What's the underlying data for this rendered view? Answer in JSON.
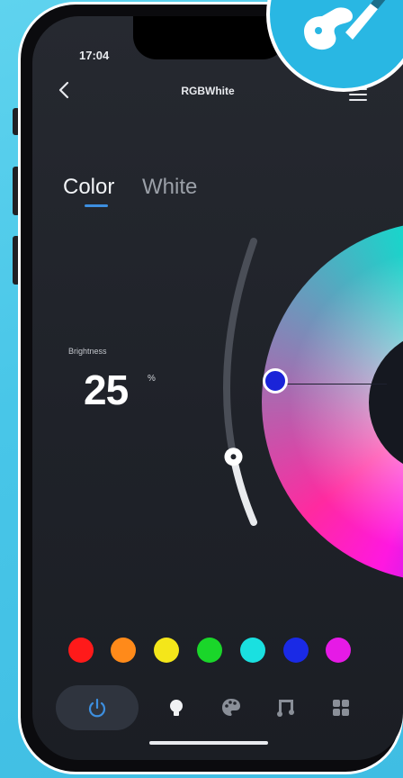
{
  "status_bar": {
    "time": "17:04"
  },
  "header": {
    "title": "RGBWhite"
  },
  "mode_tabs": [
    {
      "label": "Color",
      "active": true
    },
    {
      "label": "White",
      "active": false
    }
  ],
  "brightness": {
    "label": "Brightness",
    "value": "25",
    "unit": "%",
    "level": 0.25
  },
  "color_picker": {
    "selected_color": "#1a24d8"
  },
  "swatches": [
    {
      "name": "red",
      "color": "#ff1a1a"
    },
    {
      "name": "orange",
      "color": "#ff8a1a"
    },
    {
      "name": "yellow",
      "color": "#f4e61a"
    },
    {
      "name": "green",
      "color": "#1ad62a"
    },
    {
      "name": "cyan",
      "color": "#1ae0e0"
    },
    {
      "name": "blue",
      "color": "#1a2ae6"
    },
    {
      "name": "magenta",
      "color": "#e61ae6"
    }
  ],
  "bottom_nav": {
    "items": [
      {
        "icon": "power-icon",
        "active": true
      },
      {
        "icon": "bulb-icon",
        "active": false
      },
      {
        "icon": "palette-icon",
        "active": false
      },
      {
        "icon": "music-icon",
        "active": false
      },
      {
        "icon": "grid-icon",
        "active": false
      }
    ]
  },
  "colors": {
    "accent": "#3d8fe0",
    "background": "#22252c",
    "outer": "#48c6e8"
  }
}
